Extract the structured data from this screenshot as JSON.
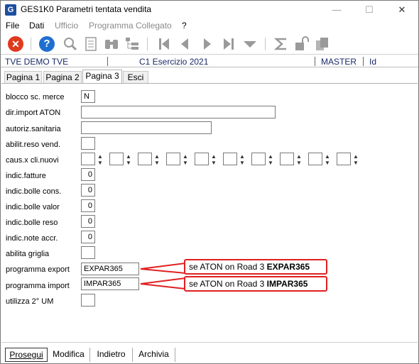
{
  "window": {
    "app_icon_text": "G",
    "title": "GES1K0   Parametri tentata vendita",
    "minimize": "—",
    "maximize": "☐",
    "close": "✕"
  },
  "menu": [
    {
      "label": "File",
      "enabled": true
    },
    {
      "label": "Dati",
      "enabled": true
    },
    {
      "label": "Ufficio",
      "enabled": false
    },
    {
      "label": "Programma Collegato",
      "enabled": false
    },
    {
      "label": "?",
      "enabled": true
    }
  ],
  "toolbar": {
    "icons": [
      "close-icon",
      "help-icon",
      "search-icon",
      "document-icon",
      "binoculars-icon",
      "tree-icon",
      "first-icon",
      "previous-icon",
      "next-icon",
      "last-icon",
      "dropdown-icon",
      "sum-icon",
      "lock-icon",
      "copy-icon"
    ],
    "close_glyph": "✕",
    "help_glyph": "?"
  },
  "status": {
    "company": "TVE DEMO TVE",
    "exercise": "C1 Esercizio 2021",
    "user": "MASTER",
    "id": "Id"
  },
  "tabs": [
    {
      "label": "Pagina 1",
      "active": false
    },
    {
      "label": "Pagina 2",
      "active": false
    },
    {
      "label": "Pagina 3",
      "active": true
    },
    {
      "label": "Esci",
      "active": false
    }
  ],
  "fields": {
    "blocco_sc_merce": {
      "label": "blocco sc. merce",
      "value": "N"
    },
    "dir_import_aton": {
      "label": "dir.import ATON",
      "value": ""
    },
    "autoriz_sanitaria": {
      "label": "autoriz.sanitaria",
      "value": ""
    },
    "abilit_reso_vend": {
      "label": "abilit.reso vend.",
      "value": ""
    },
    "caus_cli_nuovi": {
      "label": "caus.x cli.nuovi",
      "values": [
        "",
        "",
        "",
        "",
        "",
        "",
        "",
        "",
        "",
        ""
      ]
    },
    "indic_fatture": {
      "label": "indic.fatture",
      "value": "0"
    },
    "indic_bolle_cons": {
      "label": "indic.bolle cons.",
      "value": "0"
    },
    "indic_bolle_valor": {
      "label": "indic.bolle valor",
      "value": "0"
    },
    "indic_bolle_reso": {
      "label": "indic.bolle reso",
      "value": "0"
    },
    "indic_note_accr": {
      "label": "indic.note accr.",
      "value": "0"
    },
    "abilita_griglia": {
      "label": "abilita griglia",
      "value": ""
    },
    "programma_export": {
      "label": "programma export",
      "value": "EXPAR365"
    },
    "programma_import": {
      "label": "programma import",
      "value": "IMPAR365"
    },
    "utilizza_2_um": {
      "label": "utilizza 2° UM",
      "value": ""
    }
  },
  "callouts": {
    "export": {
      "text": "se ATON on Road 3 ",
      "bold": "EXPAR365"
    },
    "import": {
      "text": "se ATON on Road 3 ",
      "bold": "IMPAR365"
    }
  },
  "colors": {
    "callout_border": "#e02020",
    "status_text": "#1a2a66"
  },
  "bottom_buttons": [
    {
      "label": "Prosegui",
      "selected": true
    },
    {
      "label": "Modifica",
      "selected": false
    },
    {
      "label": "Indietro",
      "selected": false
    },
    {
      "label": "Archivia",
      "selected": false
    }
  ]
}
